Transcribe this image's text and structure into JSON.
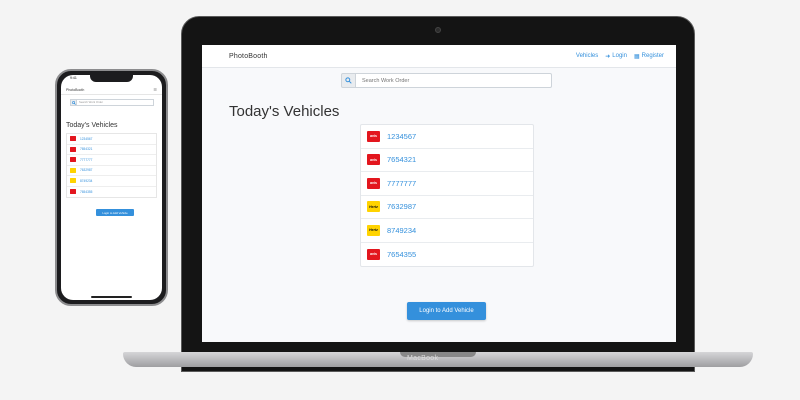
{
  "app": {
    "brand": "PhotoBooth",
    "nav": [
      {
        "label": "Vehicles",
        "icon": ""
      },
      {
        "label": "Login",
        "icon": "sign-in-icon"
      },
      {
        "label": "Register",
        "icon": "register-icon"
      }
    ]
  },
  "search": {
    "placeholder": "Search Work Order",
    "icon": "search-icon"
  },
  "page": {
    "title": "Today's Vehicles"
  },
  "vehicles": [
    {
      "number": "1234567",
      "brand": "avis",
      "logo_color": "#e3161e"
    },
    {
      "number": "7654321",
      "brand": "avis",
      "logo_color": "#e3161e"
    },
    {
      "number": "7777777",
      "brand": "avis",
      "logo_color": "#e3161e"
    },
    {
      "number": "7632987",
      "brand": "Hertz",
      "logo_color": "#ffd300"
    },
    {
      "number": "8749234",
      "brand": "Hertz",
      "logo_color": "#ffd300"
    },
    {
      "number": "7654355",
      "brand": "avis",
      "logo_color": "#e3161e"
    }
  ],
  "actions": {
    "login_add_vehicle": "Login to Add Vehicle"
  },
  "device": {
    "laptop_label": "MacBook",
    "phone_time": "9:41"
  },
  "colors": {
    "accent": "#3490dc",
    "avis_red": "#e3161e",
    "hertz_yellow": "#ffd300"
  }
}
